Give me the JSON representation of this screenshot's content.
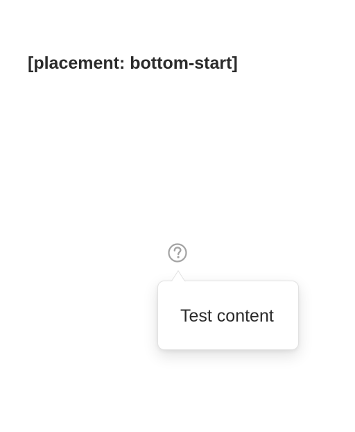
{
  "heading": "[placement: bottom-start]",
  "trigger": {
    "icon": "help-circle-icon",
    "color": "#a3a3a3"
  },
  "popover": {
    "content": "Test content"
  }
}
